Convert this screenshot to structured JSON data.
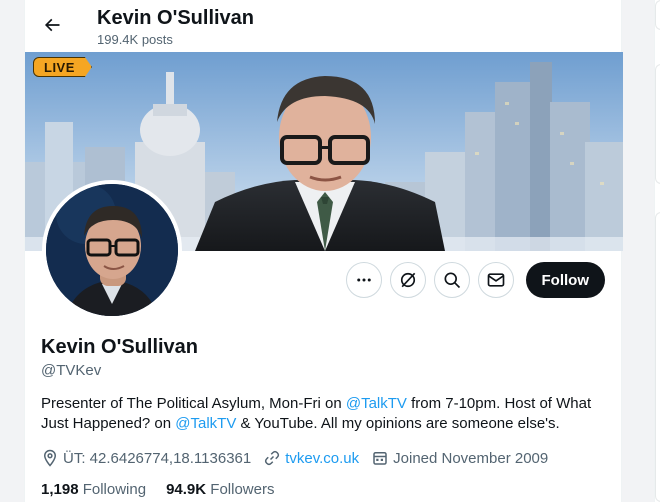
{
  "header": {
    "title": "Kevin O'Sullivan",
    "post_count": "199.4K posts"
  },
  "banner": {
    "live_label": "LIVE"
  },
  "actions": {
    "more_icon": "more-icon",
    "grok_icon": "grok-icon",
    "search_icon": "search-icon",
    "message_icon": "message-icon",
    "follow_label": "Follow"
  },
  "profile": {
    "display_name": "Kevin O'Sullivan",
    "handle": "@TVKev",
    "bio": {
      "part1": "Presenter of The Political Asylum, Mon-Fri on ",
      "mention1": "@TalkTV",
      "part2": " from 7-10pm. Host of  What Just Happened? on ",
      "mention2": "@TalkTV",
      "part3": " & YouTube. All my opinions are someone else's."
    },
    "location": "ÜT: 42.6426774,18.1136361",
    "website": "tvkev.co.uk",
    "joined": "Joined November 2009",
    "following_count": "1,198",
    "following_label": " Following",
    "followers_count": "94.9K",
    "followers_label": " Followers"
  },
  "colors": {
    "accent": "#1d9bf0",
    "text_primary": "#0f1419",
    "text_secondary": "#536471",
    "follow_bg": "#0f1419",
    "live_badge": "#f5a623"
  }
}
